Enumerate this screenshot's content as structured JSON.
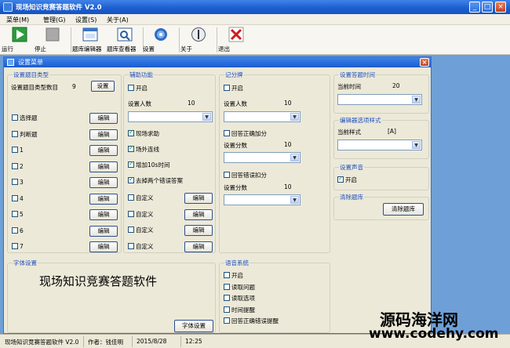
{
  "window": {
    "title": "现场知识竞赛答题软件 V2.0"
  },
  "menu": [
    "菜单(M)",
    "管理(G)",
    "设置(S)",
    "关于(A)"
  ],
  "toolbar": [
    {
      "label": "运行",
      "icon": "play-icon"
    },
    {
      "label": "停止",
      "icon": "stop-icon"
    },
    {
      "label": "题库编辑器",
      "icon": "editor-icon"
    },
    {
      "label": "题库查看器",
      "icon": "viewer-icon"
    },
    {
      "label": "设置",
      "icon": "gear-icon"
    },
    {
      "label": "关于",
      "icon": "info-icon"
    },
    {
      "label": "退出",
      "icon": "exit-icon"
    }
  ],
  "child": {
    "title": "设置菜单",
    "question_types": {
      "title": "设置题目类型",
      "count_label": "设置题目类型数目",
      "count_value": "9",
      "set_button": "设置",
      "edit_label": "编辑",
      "items": [
        "选择题",
        "判断题",
        "1",
        "2",
        "3",
        "4",
        "5",
        "6",
        "7"
      ]
    },
    "assist": {
      "title": "辅助功能",
      "enable": "开启",
      "people_label": "设置人数",
      "people_value": "10",
      "options": [
        {
          "label": "现场求助",
          "checked": true
        },
        {
          "label": "场外连线",
          "checked": true
        },
        {
          "label": "增加10s时间",
          "checked": true
        },
        {
          "label": "去掉两个错误答案",
          "checked": true
        }
      ],
      "custom": "自定义",
      "edit_label": "编辑"
    },
    "score": {
      "title": "记分牌",
      "enable": "开启",
      "people_label": "设置人数",
      "people_value": "10",
      "correct_add": "回答正确加分",
      "score1_label": "设置分数",
      "score1_value": "10",
      "wrong_sub": "回答错误扣分",
      "score2_label": "设置分数",
      "score2_value": "10"
    },
    "answer_time": {
      "title": "设置答题时间",
      "label": "当前时间",
      "value": "20"
    },
    "editor_style": {
      "title": "编辑器选项样式",
      "label": "当前样式",
      "value": "[A]"
    },
    "sound": {
      "title": "设置声音",
      "enable": "开启"
    },
    "clear": {
      "title": "清除题库",
      "button": "清除题库"
    },
    "font": {
      "title": "字体设置",
      "preview": "现场知识竞赛答题软件",
      "button": "字体设置"
    },
    "voice": {
      "title": "语音系统",
      "items": [
        "开启",
        "读取问题",
        "读取选项",
        "时间提醒",
        "回答正确错误提醒"
      ]
    }
  },
  "statusbar": [
    "现场知识竞赛答题软件 V2.0",
    "作者：钱佳明",
    "2015/8/28",
    "12:25"
  ],
  "watermark": {
    "site": "源码海洋网",
    "url": "www.codehy.com"
  }
}
